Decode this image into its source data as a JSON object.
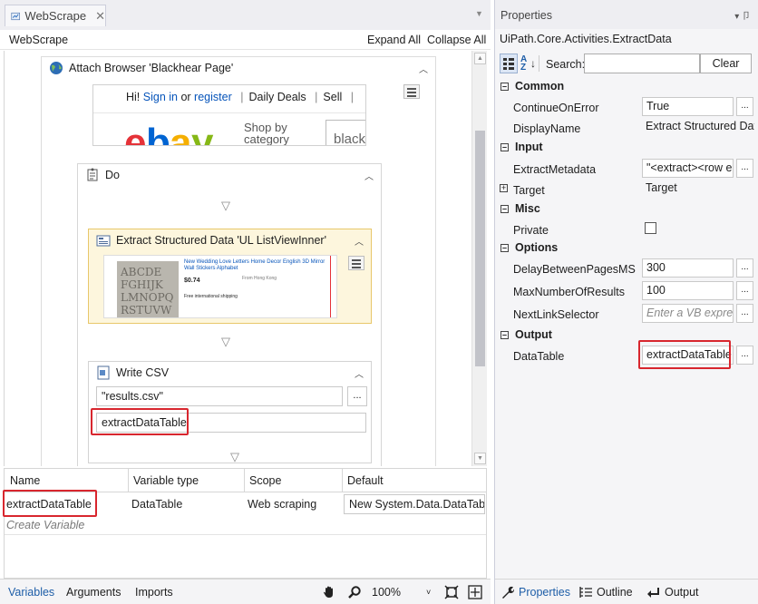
{
  "doc_tab": {
    "title": "WebScrape"
  },
  "designer": {
    "title": "WebScrape",
    "expand_all": "Expand All",
    "collapse_all": "Collapse All"
  },
  "attach_browser": {
    "title": "Attach Browser 'Blackhear Page'",
    "preview": {
      "greeting_prefix": "Hi! ",
      "sign_in": "Sign in",
      "or": " or ",
      "register": "register",
      "links": [
        "Daily Deals",
        "Sell"
      ],
      "logo": "ebay",
      "shop_by": "Shop by category",
      "search_text": "black"
    }
  },
  "do_sequence": {
    "title": "Do"
  },
  "extract_data": {
    "title": "Extract Structured Data 'UL  ListViewInner'",
    "thumb_title": "New Wedding Love Letters Home Decor English 3D Mirror Wall Stickers Alphabet",
    "thumb_price": "$0.74",
    "thumb_shipping": "Free international shipping",
    "thumb_from": "From Hong Kong"
  },
  "write_csv": {
    "title": "Write CSV",
    "file_path": "\"results.csv\"",
    "datatable": "extractDataTable",
    "ellipsis": "..."
  },
  "variables": {
    "headers": [
      "Name",
      "Variable type",
      "Scope",
      "Default"
    ],
    "rows": [
      {
        "name": "extractDataTable",
        "type": "DataTable",
        "scope": "Web scraping",
        "default": "New System.Data.DataTable"
      }
    ],
    "create_variable": "Create Variable"
  },
  "bottom_bar": {
    "tabs": [
      "Variables",
      "Arguments",
      "Imports"
    ],
    "zoom": "100%"
  },
  "properties": {
    "title": "Properties",
    "activity_type": "UiPath.Core.Activities.ExtractData",
    "search_label": "Search:",
    "clear_label": "Clear",
    "categories": {
      "common": "Common",
      "input": "Input",
      "misc": "Misc",
      "options": "Options",
      "output": "Output"
    },
    "rows": {
      "continue_on_error": {
        "label": "ContinueOnError",
        "value": "True"
      },
      "display_name": {
        "label": "DisplayName",
        "value": "Extract Structured Data"
      },
      "extract_metadata": {
        "label": "ExtractMetadata",
        "value": "\"<extract><row e"
      },
      "target": {
        "label": "Target",
        "value": "Target"
      },
      "private": {
        "label": "Private"
      },
      "delay_between_pages": {
        "label": "DelayBetweenPagesMS",
        "value": "300"
      },
      "max_results": {
        "label": "MaxNumberOfResults",
        "value": "100"
      },
      "next_link_selector": {
        "label": "NextLinkSelector",
        "placeholder": "Enter a VB expres"
      },
      "data_table": {
        "label": "DataTable",
        "value": "extractDataTable"
      }
    },
    "ellipsis": "...",
    "bottom_tabs": [
      "Properties",
      "Outline",
      "Output"
    ]
  },
  "colors": {
    "accent_blue": "#1e5ea8",
    "highlight_red": "#d8262e",
    "ebay_red": "#e53238",
    "ebay_blue": "#0064d2",
    "ebay_yellow": "#f5af02",
    "ebay_green": "#86b817"
  }
}
